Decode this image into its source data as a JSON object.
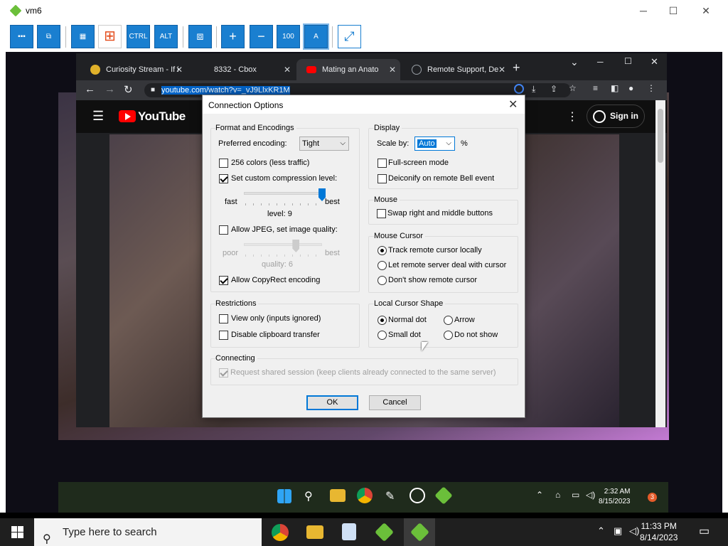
{
  "window": {
    "title": "vm6",
    "minimize": "─",
    "maximize": "☐",
    "close": "✕"
  },
  "toolbar": {
    "buttons": [
      {
        "name": "options-button",
        "label": "▪▪▪"
      },
      {
        "name": "connection-info-button",
        "label": "⧉"
      },
      {
        "name": "refresh-button",
        "label": "▦"
      },
      {
        "name": "send-win-key-button",
        "label": "⊞"
      },
      {
        "name": "send-ctrl-button",
        "label": "CTRL"
      },
      {
        "name": "send-alt-button",
        "label": "ALT"
      },
      {
        "name": "transfer-files-button",
        "label": "⧈"
      },
      {
        "name": "zoom-in-button",
        "label": "+"
      },
      {
        "name": "zoom-out-button",
        "label": "−"
      },
      {
        "name": "zoom-100-button",
        "label": "100"
      },
      {
        "name": "zoom-auto-button",
        "label": "A"
      },
      {
        "name": "fullscreen-button",
        "label": "⤢"
      }
    ]
  },
  "browser": {
    "tabs": [
      {
        "label": "Curiosity Stream - If i",
        "favicon_color": "#e0b12a",
        "active": false
      },
      {
        "label": "8332 - Cbox",
        "favicon_color": "#202124",
        "active": false
      },
      {
        "label": "Mating an Anato",
        "favicon_color": "#ff0000",
        "active": true
      },
      {
        "label": "Remote Support, De",
        "favicon_color": "#9aa0a6",
        "active": false
      }
    ],
    "new_tab": "+",
    "url_selected": "youtube.com/watch?v=_vJ9LlxKR1M",
    "controls": {
      "minimize": "─",
      "restore": "☐",
      "close": "✕",
      "dropdown": "⌄"
    }
  },
  "youtube": {
    "logo": "YouTube",
    "sign_in": "Sign in"
  },
  "dialog": {
    "title": "Connection Options",
    "close": "✕",
    "format": {
      "group": "Format and Encodings",
      "preferred_encoding_label": "Preferred encoding:",
      "preferred_encoding_value": "Tight",
      "colors256": {
        "label": "256 colors (less traffic)",
        "checked": false
      },
      "custom_compression": {
        "label": "Set custom compression level:",
        "checked": true
      },
      "compression_fast": "fast",
      "compression_best": "best",
      "compression_level": "level: 9",
      "compression_value": 9,
      "allow_jpeg": {
        "label": "Allow JPEG, set image quality:",
        "checked": false
      },
      "quality_poor": "poor",
      "quality_best": "best",
      "quality_level": "quality: 6",
      "quality_value": 6,
      "copyrect": {
        "label": "Allow CopyRect encoding",
        "checked": true
      }
    },
    "restrictions": {
      "group": "Restrictions",
      "view_only": {
        "label": "View only (inputs ignored)",
        "checked": false
      },
      "disable_clipboard": {
        "label": "Disable clipboard transfer",
        "checked": false
      }
    },
    "connecting": {
      "group": "Connecting",
      "shared": {
        "label": "Request shared session (keep clients already connected to the same server)",
        "checked": true,
        "disabled": true
      }
    },
    "display": {
      "group": "Display",
      "scale_label": "Scale by:",
      "scale_value": "Auto",
      "scale_unit": "%",
      "fullscreen": {
        "label": "Full-screen mode",
        "checked": false
      },
      "deiconify": {
        "label": "Deiconify on remote Bell event",
        "checked": false
      }
    },
    "mouse": {
      "group": "Mouse",
      "swap": {
        "label": "Swap right and middle buttons",
        "checked": false
      }
    },
    "mouse_cursor": {
      "group": "Mouse Cursor",
      "options": [
        {
          "label": "Track remote cursor locally",
          "checked": true
        },
        {
          "label": "Let remote server deal with cursor",
          "checked": false
        },
        {
          "label": "Don't show remote cursor",
          "checked": false
        }
      ]
    },
    "local_cursor": {
      "group": "Local Cursor Shape",
      "normal_dot": {
        "label": "Normal dot",
        "checked": true
      },
      "arrow": {
        "label": "Arrow",
        "checked": false
      },
      "small_dot": {
        "label": "Small dot",
        "checked": false
      },
      "do_not_show": {
        "label": "Do not show",
        "checked": false
      }
    },
    "ok": "OK",
    "cancel": "Cancel"
  },
  "remote_taskbar": {
    "time": "2:32 AM",
    "date": "8/15/2023",
    "notification_count": "3"
  },
  "taskbar": {
    "search_placeholder": "Type here to search",
    "time": "11:33 PM",
    "date": "8/14/2023"
  }
}
